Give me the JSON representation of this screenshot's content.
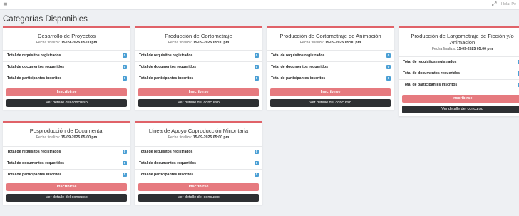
{
  "topbar": {
    "menu_icon": "menu-icon",
    "expand_icon": "fullscreen-icon",
    "user_text": "Hola: Pe"
  },
  "page": {
    "title": "Categorías Disponibles"
  },
  "labels": {
    "date_prefix": "Fecha finaliza:",
    "row_requisitos": "Total de requisitos registrados",
    "row_documentos": "Total de documentos requeridos",
    "row_participantes": "Total de participantes inscritos",
    "inscribirse": "Inscribirse",
    "ver_detalle": "Ver detalle del concurso"
  },
  "colors": {
    "accent": "#e06268",
    "primary_button": "#e67a7f",
    "dark_button": "#2e3033",
    "badge": "#4a9fd4",
    "background": "#eef0f3"
  },
  "cards": [
    {
      "title": "Desarrollo de Proyectos",
      "title_line2": "",
      "date": "15-09-2025 05:00 pm",
      "requisitos": "0",
      "documentos": "0",
      "participantes": "0"
    },
    {
      "title": "Producción de Cortometraje",
      "title_line2": "",
      "date": "15-09-2025 05:00 pm",
      "requisitos": "0",
      "documentos": "0",
      "participantes": "0"
    },
    {
      "title": "Producción de Cortometraje de Animación",
      "title_line2": "",
      "date": "15-09-2025 05:00 pm",
      "requisitos": "0",
      "documentos": "0",
      "participantes": "0"
    },
    {
      "title": "Producción de Largometraje de Ficción y/o",
      "title_line2": "Animación",
      "date": "15-09-2025 05:00 pm",
      "requisitos": "0",
      "documentos": "0",
      "participantes": "0"
    },
    {
      "title": "Posproducción de Documental",
      "title_line2": "",
      "date": "15-09-2025 05:00 pm",
      "requisitos": "0",
      "documentos": "0",
      "participantes": "0"
    },
    {
      "title": "Línea de Apoyo Coproducción Minoritaria",
      "title_line2": "",
      "date": "15-09-2025 05:00 pm",
      "requisitos": "0",
      "documentos": "0",
      "participantes": "0"
    }
  ]
}
